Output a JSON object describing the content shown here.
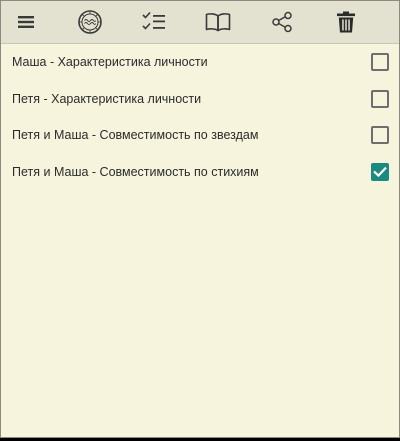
{
  "toolbar": {
    "buttons": [
      {
        "icon": "menu-icon"
      },
      {
        "icon": "zodiac-wheel-icon"
      },
      {
        "icon": "checklist-icon"
      },
      {
        "icon": "open-book-icon"
      },
      {
        "icon": "share-icon"
      },
      {
        "icon": "trash-icon"
      }
    ]
  },
  "list": {
    "items": [
      {
        "label": "Маша - Характеристика личности",
        "checked": false
      },
      {
        "label": "Петя - Характеристика личности",
        "checked": false
      },
      {
        "label": "Петя и Маша - Совместимость по звездам",
        "checked": false
      },
      {
        "label": "Петя и Маша - Совместимость по стихиям",
        "checked": true
      }
    ]
  },
  "colors": {
    "background": "#F7F4DE",
    "toolbar": "#E3E1CF",
    "accent": "#1B8A7F",
    "icon": "#3A3A3A"
  }
}
